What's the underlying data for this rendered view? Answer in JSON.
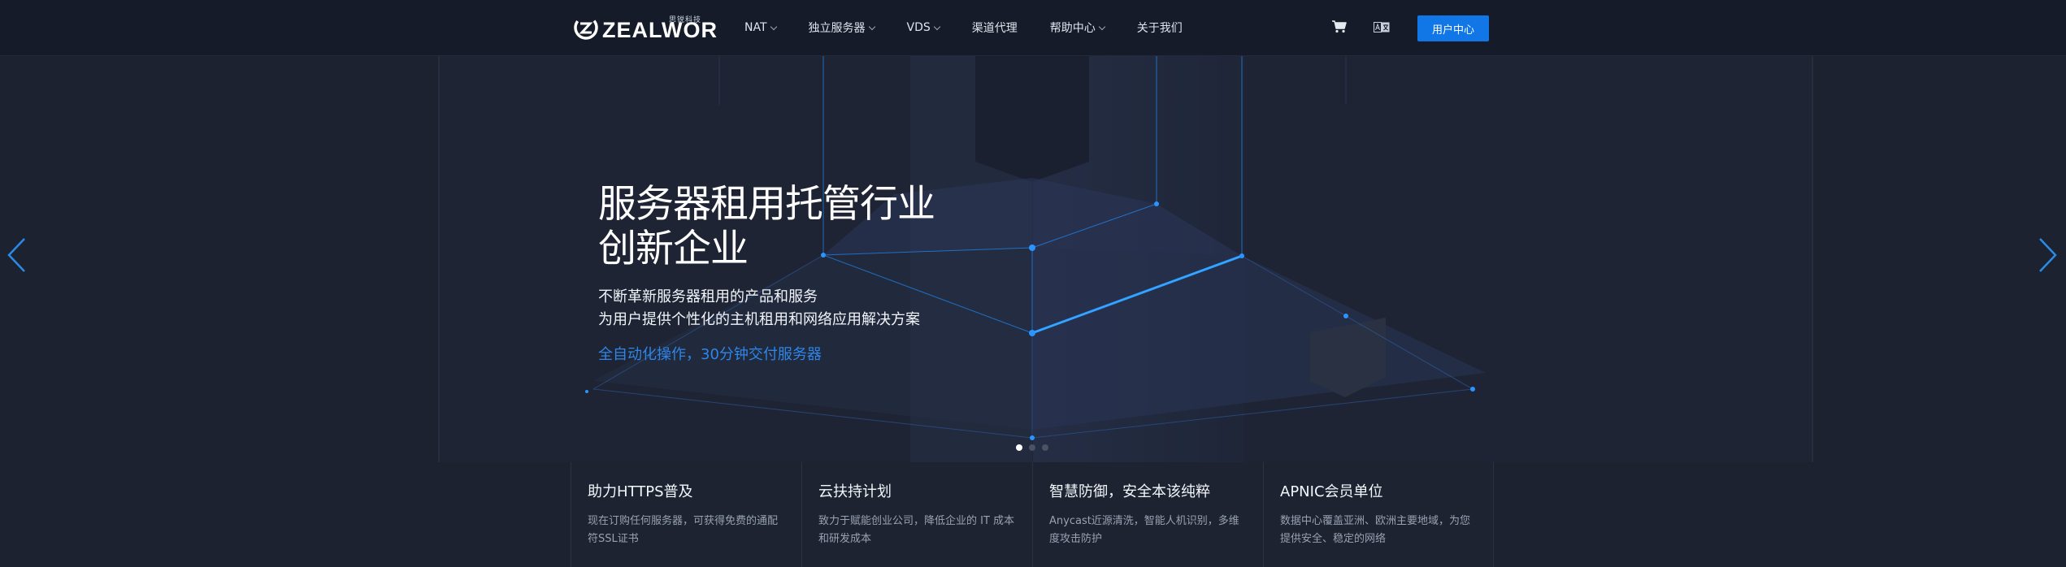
{
  "header": {
    "logo_text": "ZEALWOR",
    "logo_sub": "思锐科技",
    "nav": [
      {
        "label": "NAT",
        "dropdown": true
      },
      {
        "label": "独立服务器",
        "dropdown": true
      },
      {
        "label": "VDS",
        "dropdown": true
      },
      {
        "label": "渠道代理",
        "dropdown": false
      },
      {
        "label": "帮助中心",
        "dropdown": true
      },
      {
        "label": "关于我们",
        "dropdown": false
      }
    ],
    "cart_icon": "cart-icon",
    "lang_icon": "language-icon",
    "user_center_label": "用户中心",
    "accent_color": "#1277e6"
  },
  "hero": {
    "title_line1": "服务器租用托管行业",
    "title_line2": "创新企业",
    "desc_line1": "不断革新服务器租用的产品和服务",
    "desc_line2": "为用户提供个性化的主机租用和网络应用解决方案",
    "highlight": "全自动化操作，30分钟交付服务器",
    "highlight_color": "#2e86ea",
    "slides": 3,
    "active_slide": 1
  },
  "features": [
    {
      "title": "助力HTTPS普及",
      "desc": "现在订购任何服务器，可获得免费的通配符SSL证书"
    },
    {
      "title": "云扶持计划",
      "desc": "致力于赋能创业公司，降低企业的 IT 成本和研发成本"
    },
    {
      "title": "智慧防御，安全本该纯粹",
      "desc": "Anycast近源清洗，智能人机识别，多维度攻击防护"
    },
    {
      "title": "APNIC会员单位",
      "desc": "数据中心覆盖亚洲、欧洲主要地域，为您提供安全、稳定的网络"
    }
  ]
}
